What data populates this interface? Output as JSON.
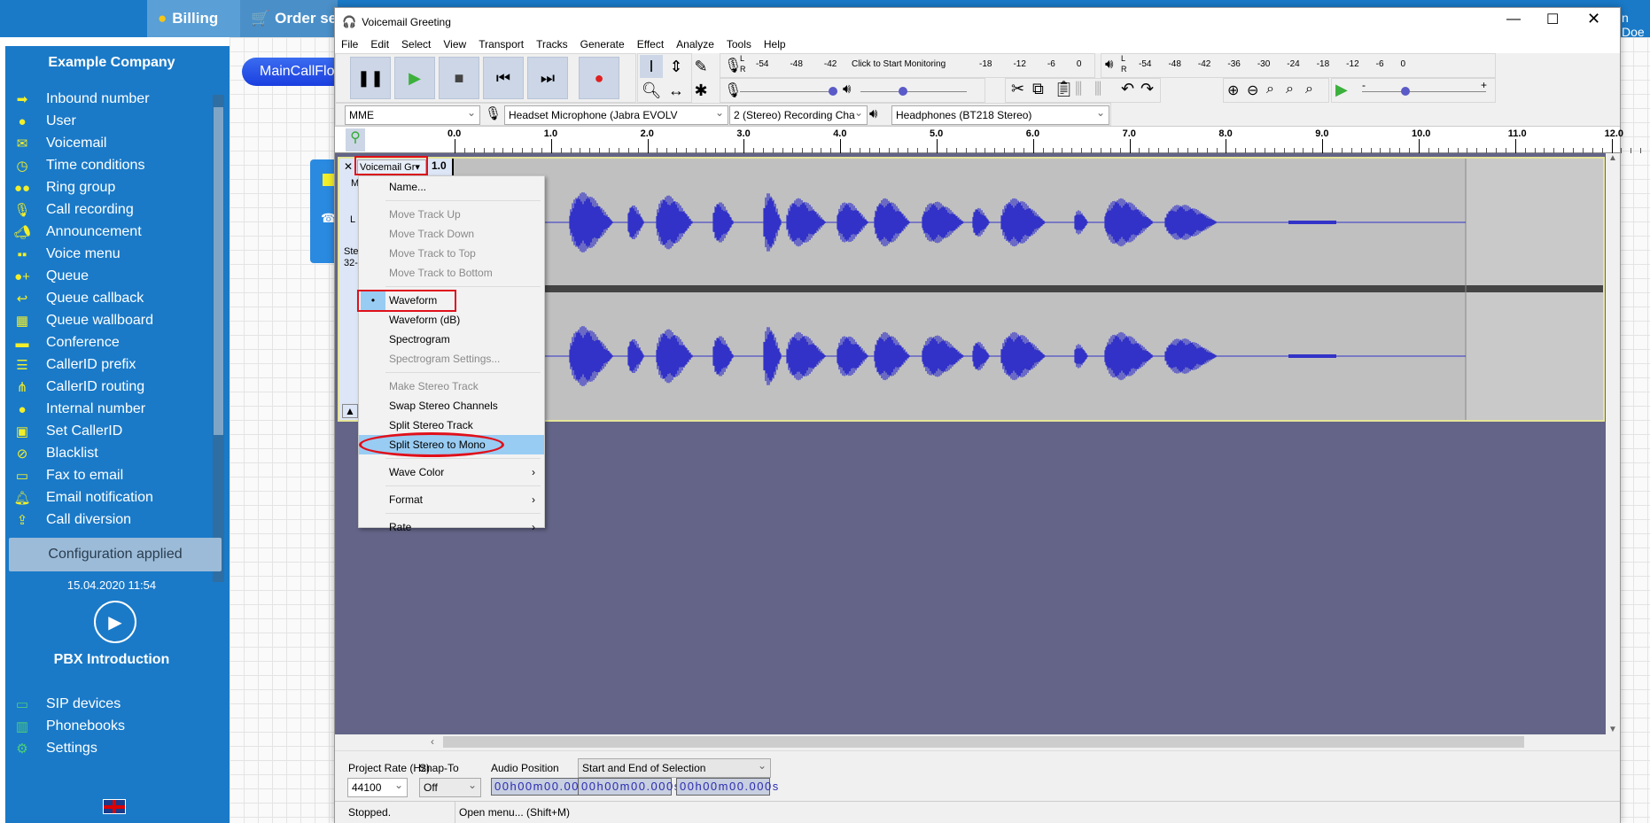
{
  "browser": {
    "tabs": [
      {
        "label": "Billing",
        "icon": "coins-icon"
      },
      {
        "label": "Order se",
        "icon": "cart-icon"
      }
    ],
    "user": "n Doe"
  },
  "sidebar": {
    "company": "Example Company",
    "items": [
      {
        "label": "Inbound number",
        "icon": "arrow-right-icon"
      },
      {
        "label": "User",
        "icon": "user-icon"
      },
      {
        "label": "Voicemail",
        "icon": "envelope-icon"
      },
      {
        "label": "Time conditions",
        "icon": "clock-icon"
      },
      {
        "label": "Ring group",
        "icon": "users-icon"
      },
      {
        "label": "Call recording",
        "icon": "microphone-icon"
      },
      {
        "label": "Announcement",
        "icon": "megaphone-icon"
      },
      {
        "label": "Voice menu",
        "icon": "grid-icon"
      },
      {
        "label": "Queue",
        "icon": "user-plus-icon"
      },
      {
        "label": "Queue callback",
        "icon": "reply-icon"
      },
      {
        "label": "Queue wallboard",
        "icon": "table-icon"
      },
      {
        "label": "Conference",
        "icon": "chat-icon"
      },
      {
        "label": "CallerID prefix",
        "icon": "list-icon"
      },
      {
        "label": "CallerID routing",
        "icon": "sitemap-icon"
      },
      {
        "label": "Internal number",
        "icon": "map-pin-icon"
      },
      {
        "label": "Set CallerID",
        "icon": "id-card-icon"
      },
      {
        "label": "Blacklist",
        "icon": "ban-icon"
      },
      {
        "label": "Fax to email",
        "icon": "fax-icon"
      },
      {
        "label": "Email notification",
        "icon": "bell-icon"
      },
      {
        "label": "Call diversion",
        "icon": "upload-icon"
      }
    ],
    "status": "Configuration applied",
    "timestamp": "15.04.2020 11:54",
    "intro": "PBX Introduction",
    "bottom_items": [
      {
        "label": "SIP devices",
        "icon": "monitor-icon"
      },
      {
        "label": "Phonebooks",
        "icon": "book-icon"
      },
      {
        "label": "Settings",
        "icon": "gear-icon"
      }
    ]
  },
  "canvas": {
    "flow_pill": "MainCallFlo"
  },
  "audacity": {
    "title": "Voicemail Greeting",
    "menu": [
      "File",
      "Edit",
      "Select",
      "View",
      "Transport",
      "Tracks",
      "Generate",
      "Effect",
      "Analyze",
      "Tools",
      "Help"
    ],
    "record_meter": {
      "channels": [
        "L",
        "R"
      ],
      "ticks_left": [
        "-54",
        "-48",
        "-42"
      ],
      "monitor_text": "Click to Start Monitoring",
      "ticks_right": [
        "-18",
        "-12",
        "-6",
        "0"
      ]
    },
    "play_meter": {
      "channels": [
        "L",
        "R"
      ],
      "ticks": [
        "-54",
        "-48",
        "-42",
        "-36",
        "-30",
        "-24",
        "-18",
        "-12",
        "-6",
        "0"
      ]
    },
    "slider_marks": {
      "minus": "-",
      "plus": "+"
    },
    "recording_volume": 0.95,
    "playback_volume": 0.4,
    "play_speed": 0.35,
    "devices": {
      "host": "MME",
      "input": "Headset Microphone (Jabra EVOLV",
      "channels": "2 (Stereo) Recording Cha",
      "output": "Headphones (BT218 Stereo)"
    },
    "ruler": [
      "0.0",
      "1.0",
      "2.0",
      "3.0",
      "4.0",
      "5.0",
      "6.0",
      "7.0",
      "8.0",
      "9.0",
      "10.0",
      "11.0",
      "12.0"
    ],
    "track": {
      "name": "Voicemail Gr",
      "gain": "1.0",
      "mute_label": "M",
      "info_1": "Ste",
      "info_2": "32-",
      "pan_l": "L"
    },
    "context_menu": [
      {
        "label": "Name...",
        "enabled": true
      },
      {
        "sep": true
      },
      {
        "label": "Move Track Up",
        "enabled": false
      },
      {
        "label": "Move Track Down",
        "enabled": false
      },
      {
        "label": "Move Track to Top",
        "enabled": false
      },
      {
        "label": "Move Track to Bottom",
        "enabled": false
      },
      {
        "sep": true
      },
      {
        "label": "Waveform",
        "enabled": true,
        "checked": true
      },
      {
        "label": "Waveform (dB)",
        "enabled": true
      },
      {
        "label": "Spectrogram",
        "enabled": true
      },
      {
        "label": "Spectrogram Settings...",
        "enabled": false
      },
      {
        "sep": true
      },
      {
        "label": "Make Stereo Track",
        "enabled": false
      },
      {
        "label": "Swap Stereo Channels",
        "enabled": true
      },
      {
        "label": "Split Stereo Track",
        "enabled": true
      },
      {
        "label": "Split Stereo to Mono",
        "enabled": true,
        "highlighted": true
      },
      {
        "sep": true
      },
      {
        "label": "Wave Color",
        "enabled": true,
        "submenu": true
      },
      {
        "sep": true
      },
      {
        "label": "Format",
        "enabled": true,
        "submenu": true
      },
      {
        "sep": true
      },
      {
        "label": "Rate",
        "enabled": true,
        "submenu": true
      }
    ],
    "selection_toolbar": {
      "project_rate_label": "Project Rate (Hz)",
      "project_rate": "44100",
      "snap_label": "Snap-To",
      "snap": "Off",
      "audio_pos_label": "Audio Position",
      "audio_pos": "00h00m00.000s",
      "selection_mode": "Start and End of Selection",
      "sel_start": "00h00m00.000s",
      "sel_end": "00h00m00.000s"
    },
    "status": {
      "left": "Stopped.",
      "right": "Open menu... (Shift+M)"
    },
    "colors": {
      "wave": "#3232c8",
      "track_bg": "#636487",
      "clip": "#c0c0c0",
      "highlight": "#e0101a"
    }
  }
}
